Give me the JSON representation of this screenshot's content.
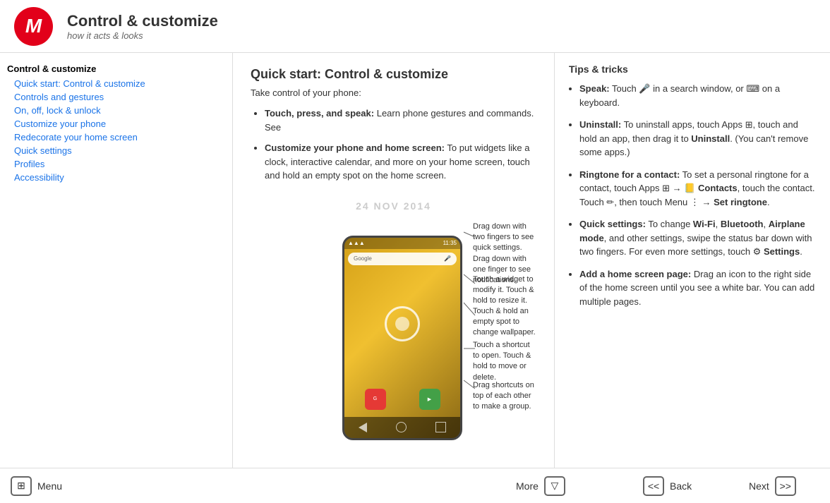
{
  "header": {
    "title": "Control & customize",
    "subtitle": "how it acts & looks",
    "logo_letter": "M"
  },
  "sidebar": {
    "section_title": "Control & customize",
    "items": [
      {
        "label": "Quick start: Control & customize",
        "id": "quick-start"
      },
      {
        "label": "Controls and gestures",
        "id": "controls-gestures"
      },
      {
        "label": "On, off, lock & unlock",
        "id": "on-off-lock"
      },
      {
        "label": "Customize your phone",
        "id": "customize-phone"
      },
      {
        "label": "Redecorate your home screen",
        "id": "redecorate"
      },
      {
        "label": "Quick settings",
        "id": "quick-settings"
      },
      {
        "label": "Profiles",
        "id": "profiles"
      },
      {
        "label": "Accessibility",
        "id": "accessibility"
      }
    ]
  },
  "main": {
    "title": "Quick start: Control & customize",
    "subtitle": "Take control of your phone:",
    "bullets": [
      {
        "bold": "Touch, press, and speak:",
        "text": " Learn phone gestures and commands. See"
      },
      {
        "bold": "Customize your phone and home screen:",
        "text": " To put widgets like a clock, interactive calendar, and more on your home screen, touch and hold an empty spot on the home screen."
      }
    ],
    "date_watermark": "24 NOV 2014",
    "callouts": [
      {
        "id": "c1",
        "text": "Drag down with two fingers to see quick settings. Drag down with one finger to see notifications."
      },
      {
        "id": "c2",
        "text": "Touch a widget to modify it. Touch & hold to resize it."
      },
      {
        "id": "c3",
        "text": "Touch & hold an empty spot to change wallpaper."
      },
      {
        "id": "c4",
        "text": "Touch a shortcut to open. Touch & hold to move or delete."
      },
      {
        "id": "c5",
        "text": "Drag shortcuts on top of each other to make a group."
      }
    ]
  },
  "tips": {
    "title": "Tips & tricks",
    "items": [
      {
        "bold": "Speak:",
        "text": " Touch 🎤 in a search window, or ⌨ on a keyboard."
      },
      {
        "bold": "Uninstall:",
        "text": " To uninstall apps, touch Apps ⊞, touch and hold an app, then drag it to Uninstall. (You can't remove some apps.)"
      },
      {
        "bold": "Ringtone for a contact:",
        "text": " To set a personal ringtone for a contact, touch Apps ⊞ → 📒 Contacts, touch the contact. Touch ✏, then touch Menu ⋮ → Set ringtone."
      },
      {
        "bold": "Quick settings:",
        "text": " To change Wi-Fi, Bluetooth, Airplane mode, and other settings, swipe the status bar down with two fingers. For even more settings, touch ⚙ Settings."
      },
      {
        "bold": "Add a home screen page:",
        "text": " Drag an icon to the right side of the home screen until you see a white bar. You can add multiple pages."
      }
    ]
  },
  "bottom": {
    "menu_label": "Menu",
    "menu_icon": "⊞",
    "more_label": "More",
    "more_icon": "▽",
    "back_label": "Back",
    "back_icon": "<<",
    "next_label": "Next",
    "next_icon": ">>"
  },
  "phone": {
    "time": "11:35",
    "search_placeholder": "Google"
  }
}
